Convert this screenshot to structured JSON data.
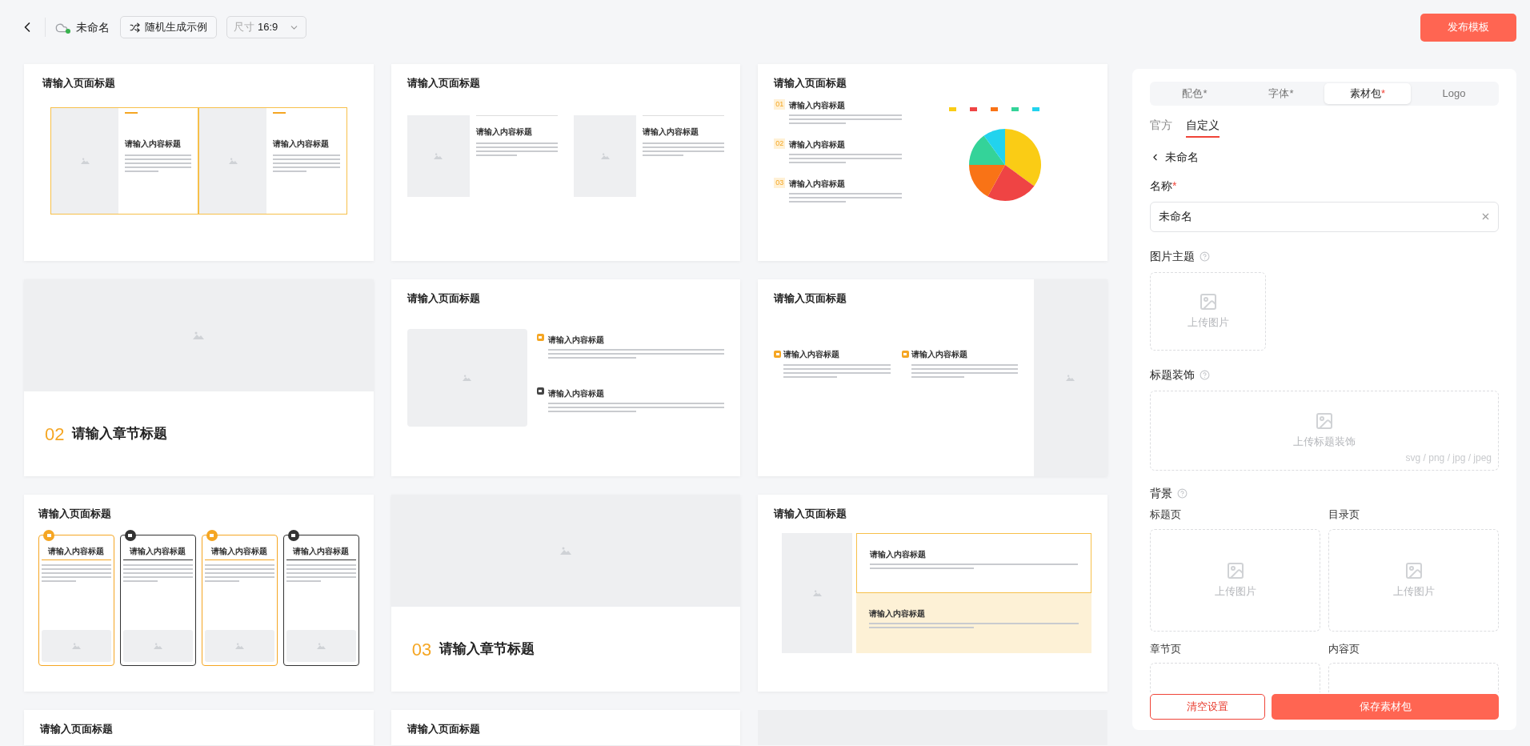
{
  "header": {
    "title": "未命名",
    "random_button": "随机生成示例",
    "size_select": {
      "label": "尺寸",
      "value": "16:9"
    },
    "publish_button": "发布模板"
  },
  "slides": [
    {
      "kind": "two-cards",
      "title": "请输入页面标题",
      "items": [
        {
          "heading": "请输入内容标题"
        },
        {
          "heading": "请输入内容标题"
        }
      ]
    },
    {
      "kind": "two-columns",
      "title": "请输入页面标题",
      "items": [
        {
          "heading": "请输入内容标题"
        },
        {
          "heading": "请输入内容标题"
        }
      ]
    },
    {
      "kind": "numbered-pie",
      "title": "请输入页面标题",
      "items": [
        {
          "number": "01",
          "heading": "请输入内容标题"
        },
        {
          "number": "02",
          "heading": "请输入内容标题"
        },
        {
          "number": "03",
          "heading": "请输入内容标题"
        }
      ]
    },
    {
      "kind": "chapter",
      "number": "02",
      "title": "请输入章节标题"
    },
    {
      "kind": "image-icon-list",
      "title": "请输入页面标题",
      "items": [
        {
          "heading": "请输入内容标题",
          "color": "#f5a623"
        },
        {
          "heading": "请输入内容标题",
          "color": "#444444"
        }
      ]
    },
    {
      "kind": "icon-columns-image",
      "title": "请输入页面标题",
      "items": [
        {
          "heading": "请输入内容标题"
        },
        {
          "heading": "请输入内容标题"
        }
      ]
    },
    {
      "kind": "four-cards",
      "title": "请输入页面标题",
      "items": [
        {
          "heading": "请输入内容标题",
          "color": "#f5a623"
        },
        {
          "heading": "请输入内容标题",
          "color": "#333333"
        },
        {
          "heading": "请输入内容标题",
          "color": "#f5a623"
        },
        {
          "heading": "请输入内容标题",
          "color": "#333333"
        }
      ]
    },
    {
      "kind": "chapter",
      "number": "03",
      "title": "请输入章节标题"
    },
    {
      "kind": "stacked-boxes",
      "title": "请输入页面标题",
      "items": [
        {
          "heading": "请输入内容标题",
          "highlighted": false
        },
        {
          "heading": "请输入内容标题",
          "highlighted": true
        }
      ]
    },
    {
      "kind": "cut-title",
      "title": "请输入页面标题"
    },
    {
      "kind": "cut-title",
      "title": "请输入页面标题"
    },
    {
      "kind": "cut-image"
    }
  ],
  "panel": {
    "tabs": [
      {
        "label": "配色",
        "mark": "*",
        "selected": false
      },
      {
        "label": "字体",
        "mark": "*",
        "selected": false
      },
      {
        "label": "素材包",
        "mark": "*",
        "selected": true
      },
      {
        "label": "Logo",
        "selected": false
      }
    ],
    "subtabs": [
      {
        "label": "官方",
        "selected": false
      },
      {
        "label": "自定义",
        "selected": true
      }
    ],
    "back_label": "未命名",
    "name_field": {
      "label": "名称",
      "required_mark": "*",
      "value": "未命名"
    },
    "image_theme": {
      "label": "图片主题",
      "upload": "上传图片"
    },
    "title_decoration": {
      "label": "标题装饰",
      "upload": "上传标题装饰",
      "formats": "svg / png / jpg / jpeg"
    },
    "background": {
      "label": "背景",
      "pages": [
        {
          "label": "标题页",
          "upload": "上传图片"
        },
        {
          "label": "目录页",
          "upload": "上传图片"
        },
        {
          "label": "章节页"
        },
        {
          "label": "内容页"
        }
      ]
    },
    "buttons": {
      "clear": "清空设置",
      "save": "保存素材包"
    }
  }
}
